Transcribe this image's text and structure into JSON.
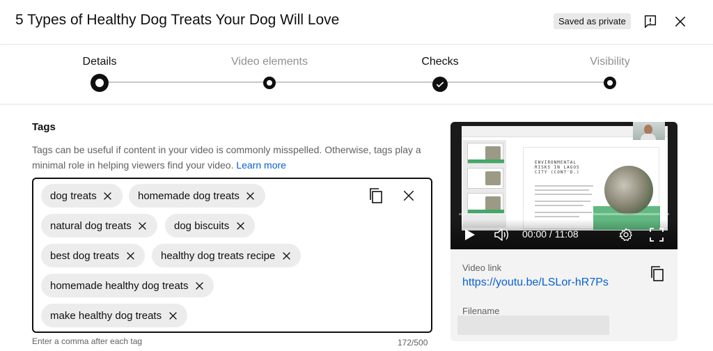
{
  "header": {
    "title": "5 Types of Healthy Dog Treats Your Dog Will Love",
    "saved_badge": "Saved as private",
    "feedback_icon": "feedback-icon",
    "close_icon": "close-icon"
  },
  "stepper": {
    "steps": [
      {
        "label": "Details",
        "state": "current"
      },
      {
        "label": "Video elements",
        "state": "pending"
      },
      {
        "label": "Checks",
        "state": "done"
      },
      {
        "label": "Visibility",
        "state": "pending"
      }
    ]
  },
  "tags": {
    "heading": "Tags",
    "description": "Tags can be useful if content in your video is commonly misspelled. Otherwise, tags play a minimal role in helping viewers find your video.",
    "learn_more": "Learn more",
    "chips": [
      "dog treats",
      "homemade dog treats",
      "natural dog treats",
      "dog biscuits",
      "best dog treats",
      "healthy dog treats recipe",
      "homemade healthy dog treats",
      "make healthy dog treats"
    ],
    "hint": "Enter a comma after each tag",
    "count": "172/500"
  },
  "preview": {
    "slide_title": "ENVIRONMENTAL RISKS IN LAGOS CITY (CONT'D.)",
    "time": "00:00 / 11:08",
    "progress": 0,
    "video_link_label": "Video link",
    "video_link": "https://youtu.be/LSLor-hR7Ps",
    "filename_label": "Filename"
  },
  "colors": {
    "accent_link": "#065fd4",
    "text_primary": "#0f0f0f",
    "text_secondary": "#606060",
    "chip_bg": "#ececec"
  }
}
